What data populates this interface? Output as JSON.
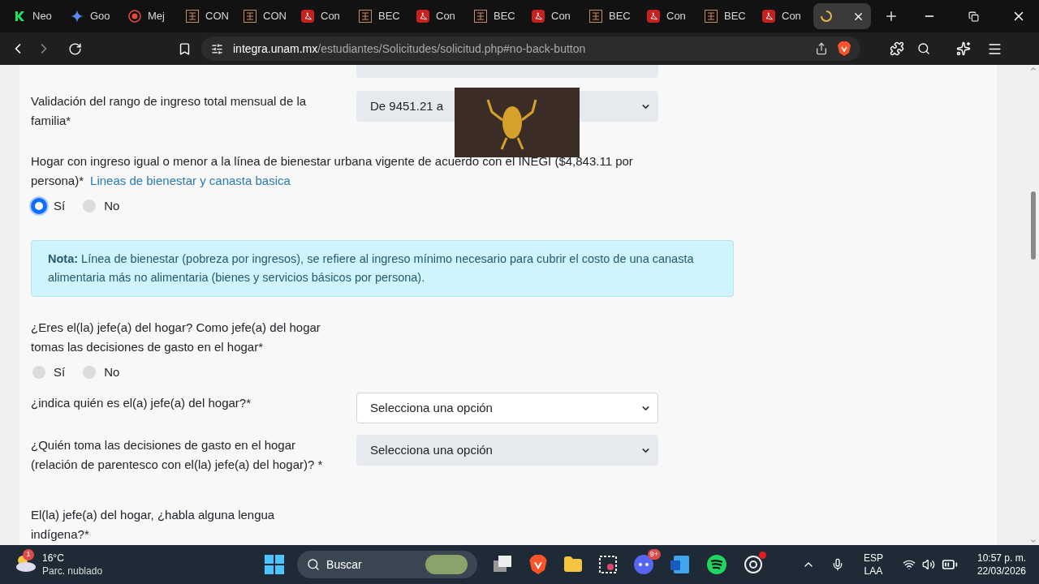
{
  "browser": {
    "tabs": [
      {
        "kind": "k",
        "title": "Neo",
        "selected": false
      },
      {
        "kind": "gem",
        "title": "Goo",
        "selected": false
      },
      {
        "kind": "shield",
        "title": "Mej",
        "selected": false
      },
      {
        "kind": "unam",
        "title": "CON",
        "selected": false
      },
      {
        "kind": "unam",
        "title": "CON",
        "selected": false
      },
      {
        "kind": "pdf",
        "title": "Con",
        "selected": false
      },
      {
        "kind": "unam",
        "title": "BEC",
        "selected": false
      },
      {
        "kind": "pdf",
        "title": "Con",
        "selected": false
      },
      {
        "kind": "unam",
        "title": "BEC",
        "selected": false
      },
      {
        "kind": "pdf",
        "title": "Con",
        "selected": false
      },
      {
        "kind": "unam",
        "title": "BEC",
        "selected": false
      },
      {
        "kind": "pdf",
        "title": "Con",
        "selected": false
      },
      {
        "kind": "unam",
        "title": "BEC",
        "selected": false
      },
      {
        "kind": "pdf",
        "title": "Con",
        "selected": false
      },
      {
        "kind": "loading",
        "selected": true
      }
    ],
    "url_host": "integra.unam.mx",
    "url_path": "/estudiantes/Solicitudes/solicitud.php#no-back-button"
  },
  "form": {
    "fields": [
      {
        "kind": "select",
        "label": "Validación del rango de ingreso total mensual de la familia*",
        "value": "De 9451.21 a",
        "disabled": true
      },
      {
        "kind": "radio",
        "label": "Hogar con ingreso igual o menor a la línea de bienestar urbana vigente de acuerdo con el INEGI ($4,843.11 por persona)*",
        "link": "Lineas de bienestar y canasta basica",
        "options": [
          {
            "label": "Sí",
            "selected": true
          },
          {
            "label": "No",
            "selected": false
          }
        ]
      },
      {
        "kind": "note",
        "title": "Nota:",
        "text": "Línea de bienestar (pobreza por ingresos), se refiere al ingreso mínimo necesario para cubrir el costo de una canasta alimentaria más no alimentaria (bienes y servicios básicos por persona)."
      },
      {
        "kind": "radio",
        "label": "¿Eres el(la) jefe(a) del hogar? Como jefe(a) del hogar tomas las decisiones de gasto en el hogar*",
        "options": [
          {
            "label": "Sí",
            "selected": false
          },
          {
            "label": "No",
            "selected": false
          }
        ]
      },
      {
        "kind": "select",
        "label": "¿indica quién es el(a) jefe(a) del hogar?*",
        "value": "Selecciona una opción",
        "disabled": false
      },
      {
        "kind": "select",
        "label": "¿Quién toma las decisiones de gasto en el hogar (relación de parentesco con el(la) jefe(a) del hogar)? *",
        "value": "Selecciona una opción",
        "disabled": true
      },
      {
        "kind": "text",
        "label": "El(la) jefe(a) del hogar, ¿habla alguna lengua indígena?*"
      }
    ]
  },
  "taskbar": {
    "weather_badge": "1",
    "temperature": "16°C",
    "weather": "Parc. nublado",
    "search": "Buscar",
    "discord_badge": "9+",
    "language": "ESP",
    "layout": "LAA",
    "time": "10:57 p. m.",
    "date": "22/03/2026"
  }
}
